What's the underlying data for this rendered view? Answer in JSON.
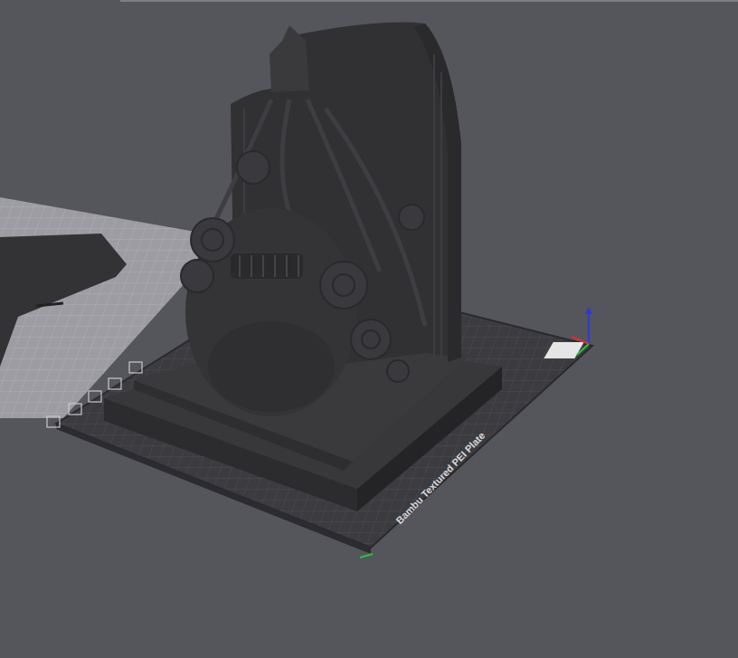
{
  "viewport": {
    "plate_label": "Bambu Textured PEI Plate"
  }
}
